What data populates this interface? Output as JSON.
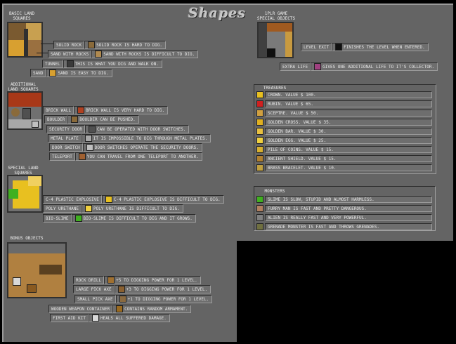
{
  "title": "Shapes",
  "basic": {
    "heading": "Basic Land Squares",
    "items": [
      {
        "label": "Solid Rock",
        "desc": "Solid rock is hard to dig.",
        "icon": "solid-rock-tile"
      },
      {
        "label": "Sand with Rocks",
        "desc": "Sand with rocks is difficult to dig.",
        "icon": "sand-rocks-tile"
      },
      {
        "label": "Tunnel",
        "desc": "This is what you dig and walk on.",
        "icon": "tunnel-tile"
      },
      {
        "label": "Sand",
        "desc": "Sand is easy to dig.",
        "icon": "sand-tile"
      }
    ]
  },
  "additional": {
    "heading": "Additional Land Squares",
    "items": [
      {
        "label": "Brick Wall",
        "desc": "Brick wall is very hard to dig.",
        "icon": "brick-wall-tile"
      },
      {
        "label": "Boulder",
        "desc": "Boulder can be pushed.",
        "icon": "boulder-tile"
      },
      {
        "label": "Security Door",
        "desc": "Can be operated with door switches.",
        "icon": "security-door-tile"
      },
      {
        "label": "Metal Plate",
        "desc": "It is impossible to dig through metal plates.",
        "icon": "metal-plate-tile"
      },
      {
        "label": "Door Switch",
        "desc": "Door switches operate the security doors.",
        "icon": "door-switch-tile"
      },
      {
        "label": "Teleport",
        "desc": "You can travel from one teleport to another.",
        "icon": "teleport-tile"
      }
    ]
  },
  "special": {
    "heading": "Special Land Squares",
    "items": [
      {
        "label": "C-4 Plastic Explosive",
        "desc": "C-4 plastic explosive is difficult to dig.",
        "icon": "c4-tile"
      },
      {
        "label": "Poly Urethane",
        "desc": "Poly urethane is difficult to dig.",
        "icon": "poly-urethane-tile"
      },
      {
        "label": "Bio-Slime",
        "desc": "Bio-slime is difficult to dig and it grows.",
        "icon": "bio-slime-tile"
      }
    ]
  },
  "bonus": {
    "heading": "Bonus Objects",
    "items": [
      {
        "label": "Rock Drill",
        "desc": "+5 to digging power for 1 level.",
        "icon": "rock-drill-icon"
      },
      {
        "label": "Large Pick Axe",
        "desc": "+3 to digging power for 1 level.",
        "icon": "large-pick-axe-icon"
      },
      {
        "label": "Small Pick Axe",
        "desc": "+1 to digging power for 1 level.",
        "icon": "small-pick-axe-icon"
      },
      {
        "label": "Wooden Weapon Container",
        "desc": "Contains random armament.",
        "icon": "weapon-container-icon"
      },
      {
        "label": "First Aid Kit",
        "desc": "Heals all suffered damage.",
        "icon": "first-aid-icon"
      }
    ]
  },
  "special_objects": {
    "heading": "1plr game special objects",
    "items": [
      {
        "label": "Level Exit",
        "desc": "Finishes the level when entered.",
        "icon": "level-exit-icon"
      },
      {
        "label": "Extra Life",
        "desc": "Gives one additional life to it's collector.",
        "icon": "extra-life-icon"
      }
    ]
  },
  "treasures": {
    "heading": "Treasures",
    "items": [
      {
        "text": "Crown. Value $ 100.",
        "icon": "crown-icon"
      },
      {
        "text": "Rubin. Value $ 65.",
        "icon": "rubin-icon"
      },
      {
        "text": "Sceptre. Value $ 50.",
        "icon": "sceptre-icon"
      },
      {
        "text": "Golden cross. Value $ 35.",
        "icon": "golden-cross-icon"
      },
      {
        "text": "Golden bar. Value $ 30.",
        "icon": "golden-bar-icon"
      },
      {
        "text": "Golden egg. Value $ 25.",
        "icon": "golden-egg-icon"
      },
      {
        "text": "Pile of coins. Value $ 15.",
        "icon": "coins-icon"
      },
      {
        "text": "Ancient shield. Value $ 15.",
        "icon": "shield-icon"
      },
      {
        "text": "Brass bracelet. Value $ 10.",
        "icon": "bracelet-icon"
      }
    ]
  },
  "monsters": {
    "heading": "Monsters",
    "items": [
      {
        "text": "Slime is slow, stupid and almost harmless.",
        "icon": "slime-icon"
      },
      {
        "text": "Furry man is fast and pretty dangerous.",
        "icon": "furry-man-icon"
      },
      {
        "text": "Alien is really fast and very powerful.",
        "icon": "alien-icon"
      },
      {
        "text": "Grenade monster is fast and throws grenades.",
        "icon": "grenade-monster-icon"
      }
    ]
  },
  "colors": {
    "background": "#646464",
    "rock": "#8a6a3a",
    "sand": "#c89a40",
    "brick": "#b04020",
    "explosive": "#e8c020",
    "slime": "#40b020"
  }
}
